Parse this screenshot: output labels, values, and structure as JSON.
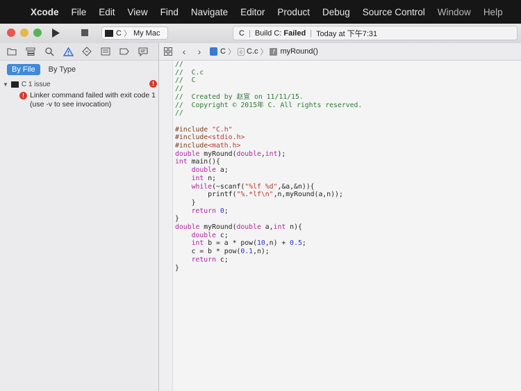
{
  "menubar": {
    "app": "Xcode",
    "items": [
      "File",
      "Edit",
      "View",
      "Find",
      "Navigate",
      "Editor",
      "Product",
      "Debug",
      "Source Control",
      "Window",
      "Help"
    ]
  },
  "toolbar": {
    "scheme_target": "C",
    "destination": "My Mac",
    "activity": {
      "project": "C",
      "build_label": "Build C:",
      "build_status": "Failed",
      "time": "Today at 下午7:31"
    }
  },
  "navigator": {
    "filter_by_file": "By File",
    "filter_by_type": "By Type",
    "issue_group": "C 1 issue",
    "issue_message": "Linker command failed with exit code 1 (use -v to see invocation)"
  },
  "jumpbar": {
    "project": "C",
    "folder": "C",
    "file": "C.c",
    "symbol": "myRound()"
  },
  "editor": {
    "lines": [
      "//",
      "//  C.c",
      "//  C",
      "//",
      "//  Created by 赵宣 on 11/11/15.",
      "//  Copyright © 2015年 C. All rights reserved.",
      "//",
      "",
      "#include \"C.h\"",
      "#include<stdio.h>",
      "#include<math.h>",
      "double myRound(double,int);",
      "int main(){",
      "    double a;",
      "    int n;",
      "    while(~scanf(\"%lf %d\",&a,&n)){",
      "        printf(\"%.*lf\\n\",n,myRound(a,n));",
      "    }",
      "    return 0;",
      "}",
      "double myRound(double a,int n){",
      "    double c;",
      "    int b = a * pow(10,n) + 0.5;",
      "    c = b * pow(0.1,n);",
      "    return c;",
      "}"
    ]
  },
  "colors": {
    "error": "#d9392c",
    "selection": "#3f8ad9",
    "comment": "#2e7a34",
    "keyword": "#b0249f",
    "string": "#c2362a",
    "number": "#2b2fd4",
    "preprocessor": "#7a3f1e"
  }
}
